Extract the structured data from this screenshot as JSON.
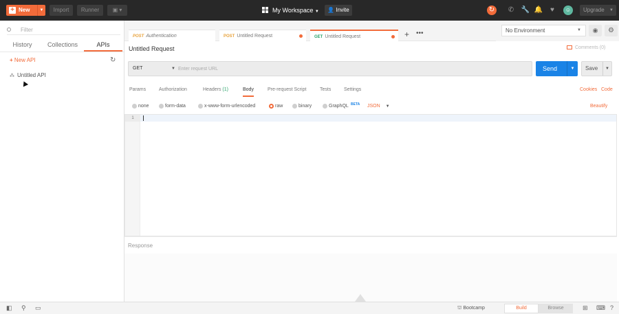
{
  "topbar": {
    "new_label": "New",
    "import_label": "Import",
    "runner_label": "Runner",
    "workspace_label": "My Workspace",
    "invite_label": "Invite",
    "upgrade_label": "Upgrade",
    "accent_color": "#f26b3a"
  },
  "sidebar": {
    "filter_placeholder": "Filter",
    "tabs": [
      {
        "label": "History"
      },
      {
        "label": "Collections"
      },
      {
        "label": "APIs",
        "active": true
      }
    ],
    "new_api_label": "New API",
    "items": [
      {
        "label": "Untitled API"
      }
    ]
  },
  "request_tabs": [
    {
      "method": "POST",
      "label": "Authentication",
      "method_color": "#e8a33d"
    },
    {
      "method": "POST",
      "label": "Untitled Request",
      "method_color": "#e8a33d"
    },
    {
      "method": "GET",
      "label": "Untitled Request",
      "method_color": "#29a36a",
      "active": true
    }
  ],
  "environment": {
    "selected": "No Environment"
  },
  "request": {
    "title": "Untitled Request",
    "comments_label": "Comments (0)",
    "method": "GET",
    "url_placeholder": "Enter request URL",
    "send_label": "Send",
    "save_label": "Save"
  },
  "param_tabs": [
    {
      "label": "Params"
    },
    {
      "label": "Authorization"
    },
    {
      "label": "Headers",
      "count": "(1)"
    },
    {
      "label": "Body",
      "active": true
    },
    {
      "label": "Pre-request Script"
    },
    {
      "label": "Tests"
    },
    {
      "label": "Settings"
    }
  ],
  "links": {
    "cookies": "Cookies",
    "code": "Code",
    "beautify": "Beautify"
  },
  "body_types": [
    {
      "label": "none"
    },
    {
      "label": "form-data"
    },
    {
      "label": "x-www-form-urlencoded"
    },
    {
      "label": "raw",
      "selected": true
    },
    {
      "label": "binary"
    },
    {
      "label": "GraphQL"
    }
  ],
  "beta_badge": "BETA",
  "content_type": "JSON",
  "editor": {
    "line_number": "1"
  },
  "response": {
    "label": "Response"
  },
  "statusbar": {
    "bootcamp_label": "Bootcamp",
    "build_label": "Build",
    "browse_label": "Browse"
  },
  "icons": [
    "plus-icon",
    "workspace-grid-icon",
    "invite-user-icon",
    "sync-icon",
    "satellite-icon",
    "wrench-icon",
    "bell-icon",
    "heart-icon",
    "avatar",
    "search-icon",
    "refresh-icon",
    "api-icon",
    "eye-icon",
    "gear-icon",
    "comment-icon",
    "sidebar-toggle-icon",
    "find-icon",
    "console-icon",
    "layout-icon",
    "keyboard-icon",
    "help-icon"
  ]
}
